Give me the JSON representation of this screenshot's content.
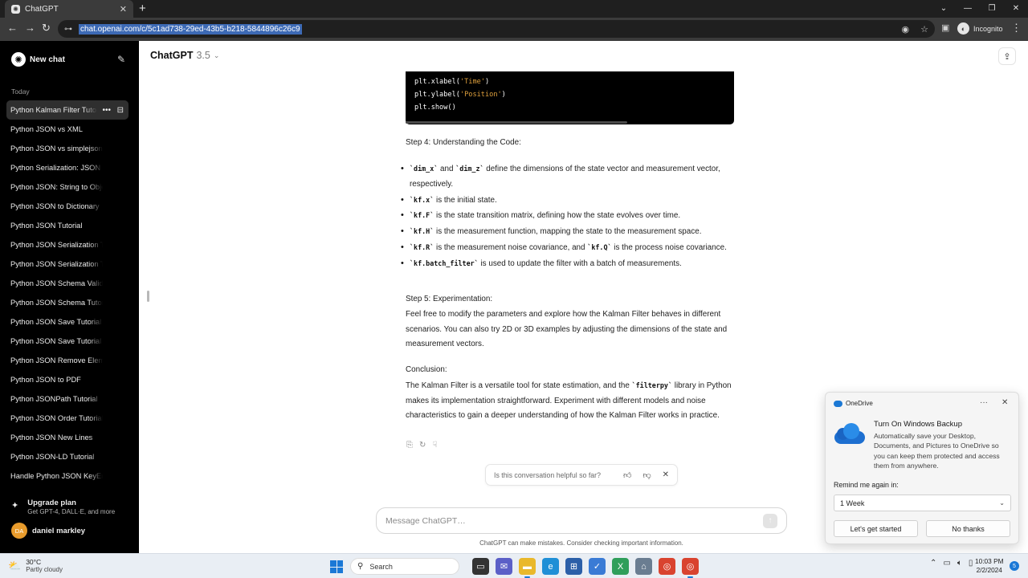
{
  "browser": {
    "tab_title": "ChatGPT",
    "url": "chat.openai.com/c/5c1ad738-29ed-43b5-b218-5844896c26c9",
    "profile_label": "Incognito"
  },
  "sidebar": {
    "new_chat": "New chat",
    "section_today": "Today",
    "history": [
      "Python Kalman Filter Tutorial",
      "Python JSON vs XML",
      "Python JSON vs simplejson",
      "Python Serialization: JSON vs Pickle",
      "Python JSON: String to Object",
      "Python JSON to Dictionary",
      "Python JSON Tutorial",
      "Python JSON Serialization Tutorial",
      "Python JSON Serialization Tutorial",
      "Python JSON Schema Validation",
      "Python JSON Schema Tutorial",
      "Python JSON Save Tutorial",
      "Python JSON Save Tutorial",
      "Python JSON Remove Element",
      "Python JSON to PDF",
      "Python JSONPath Tutorial",
      "Python JSON Order Tutorial",
      "Python JSON New Lines",
      "Python JSON-LD Tutorial",
      "Handle Python JSON KeyError"
    ],
    "upgrade_title": "Upgrade plan",
    "upgrade_sub": "Get GPT-4, DALL·E, and more",
    "user_initials": "DA",
    "user_name": "daniel markley"
  },
  "header": {
    "model": "ChatGPT",
    "version": "3.5"
  },
  "code": {
    "lines": [
      {
        "pre": "plt.xlabel(",
        "str": "'Time'",
        "post": ")"
      },
      {
        "pre": "plt.ylabel(",
        "str": "'Position'",
        "post": ")"
      },
      {
        "pre": "plt.show()",
        "str": "",
        "post": ""
      }
    ]
  },
  "message": {
    "step4_heading": "Step 4: Understanding the Code:",
    "b1_code1": "`dim_x`",
    "b1_and": " and ",
    "b1_code2": "`dim_z`",
    "b1_text": " define the dimensions of the state vector and measurement vector, respectively.",
    "b2_code": "`kf.x`",
    "b2_text": " is the initial state.",
    "b3_code": "`kf.F`",
    "b3_text": " is the state transition matrix, defining how the state evolves over time.",
    "b4_code": "`kf.H`",
    "b4_text": " is the measurement function, mapping the state to the measurement space.",
    "b5_code1": "`kf.R`",
    "b5_text1": " is the measurement noise covariance, and ",
    "b5_code2": "`kf.Q`",
    "b5_text2": " is the process noise covariance.",
    "b6_code": "`kf.batch_filter`",
    "b6_text": " is used to update the filter with a batch of measurements.",
    "step5_heading": "Step 5: Experimentation:",
    "step5_body": "Feel free to modify the parameters and explore how the Kalman Filter behaves in different scenarios. You can also try 2D or 3D examples by adjusting the dimensions of the state and measurement vectors.",
    "conclusion_heading": "Conclusion:",
    "concl_text1": "The Kalman Filter is a versatile tool for state estimation, and the ",
    "concl_code": "`filterpy`",
    "concl_text2": " library in Python makes its implementation straightforward. Experiment with different models and noise characteristics to gain a deeper understanding of how the Kalman Filter works in practice."
  },
  "feedback": {
    "question": "Is this conversation helpful so far?"
  },
  "composer": {
    "placeholder": "Message ChatGPT…",
    "disclaimer": "ChatGPT can make mistakes. Consider checking important information."
  },
  "toast": {
    "app": "OneDrive",
    "title": "Turn On Windows Backup",
    "body": "Automatically save your Desktop, Documents, and Pictures to OneDrive so you can keep them protected and access them from anywhere.",
    "remind_label": "Remind me again in:",
    "remind_value": "1 Week",
    "primary": "Let's get started",
    "secondary": "No thanks"
  },
  "taskbar": {
    "temp": "30°C",
    "condition": "Partly cloudy",
    "search": "Search",
    "time": "10:03 PM",
    "date": "2/2/2024",
    "notif_count": "5"
  },
  "colors": {
    "sidebar_bg": "#000000",
    "accent_blue": "#1a78d6",
    "code_string": "#e0a13d"
  }
}
